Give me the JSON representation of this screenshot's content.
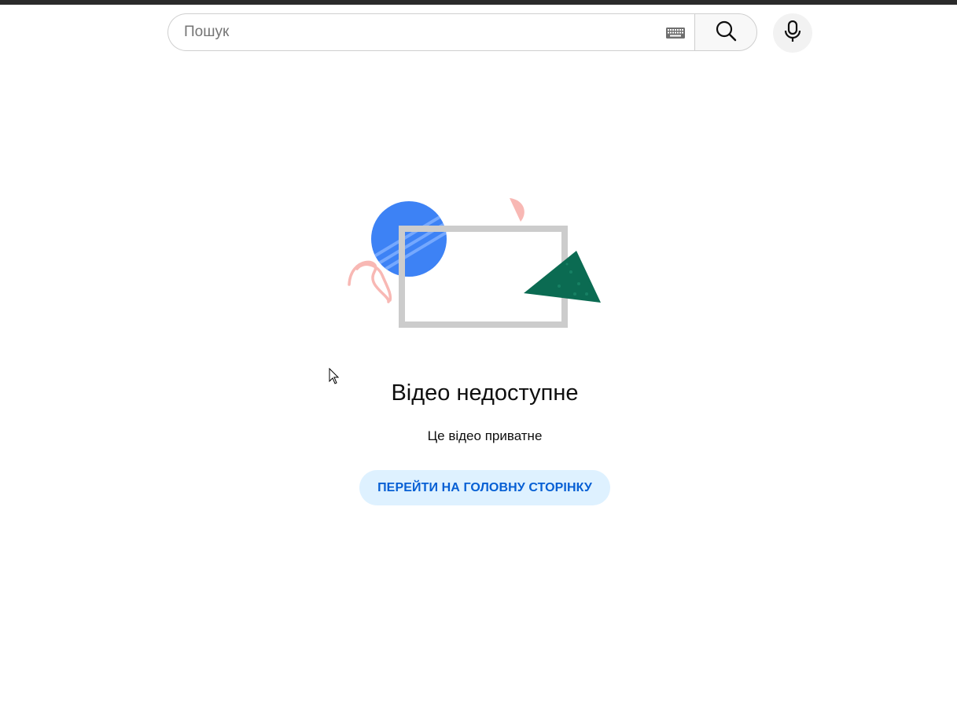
{
  "search": {
    "placeholder": "Пошук",
    "value": ""
  },
  "icons": {
    "keyboard": "keyboard-icon",
    "search": "search-icon",
    "mic": "microphone-icon"
  },
  "error": {
    "title": "Відео недоступне",
    "message": "Це відео приватне",
    "home_button_label": "ПЕРЕЙТИ НА ГОЛОВНУ СТОРІНКУ"
  },
  "colors": {
    "top_bar": "#2b2b2b",
    "button_bg": "#def1ff",
    "button_text": "#065fd4",
    "illustration_circle": "#3d82f5",
    "illustration_triangle": "#0b6b52",
    "illustration_frame": "#cccccc",
    "illustration_accent": "#f8b8b4"
  }
}
